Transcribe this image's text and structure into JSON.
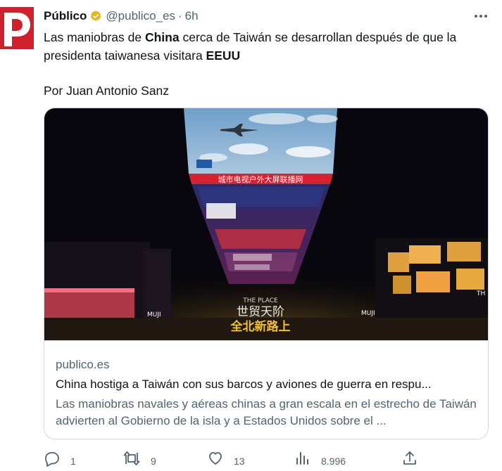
{
  "tweet": {
    "author_name": "Público",
    "handle": "@publico_es",
    "separator": "·",
    "time": "6h",
    "text_parts": [
      "Las maniobras de ",
      "China",
      " cerca de Taiwán se desarrollan después de que la presidenta taiwanesa visitara ",
      "EEUU"
    ],
    "byline": "Por Juan Antonio Sanz"
  },
  "card": {
    "domain": "publico.es",
    "title": "China hostiga a Taiwán con sus barcos y aviones de guerra en respu...",
    "description": "Las maniobras navales y aéreas chinas a gran escala en el estrecho de Taiwán advierten al Gobierno de la isla y a Estados Unidos sobre el ...",
    "image_text": {
      "screen_banner": "城市电视户外大屏联播网",
      "venue": "THE PLACE",
      "venue_chinese": "世贸天阶",
      "bottom_sign": "全北新路上",
      "store_left": "MUJI",
      "store_right": "MUJI",
      "store_far_right": "TH"
    }
  },
  "actions": {
    "reply_count": "1",
    "retweet_count": "9",
    "like_count": "13",
    "views_count": "8.996"
  },
  "colors": {
    "brand_red": "#d0202e",
    "verified_gold": "#e2b719",
    "secondary_text": "#536471",
    "border": "#cfd9de"
  },
  "icons": [
    "verified-badge-icon",
    "more-options-icon",
    "reply-icon",
    "retweet-icon",
    "like-icon",
    "views-icon",
    "share-icon"
  ]
}
